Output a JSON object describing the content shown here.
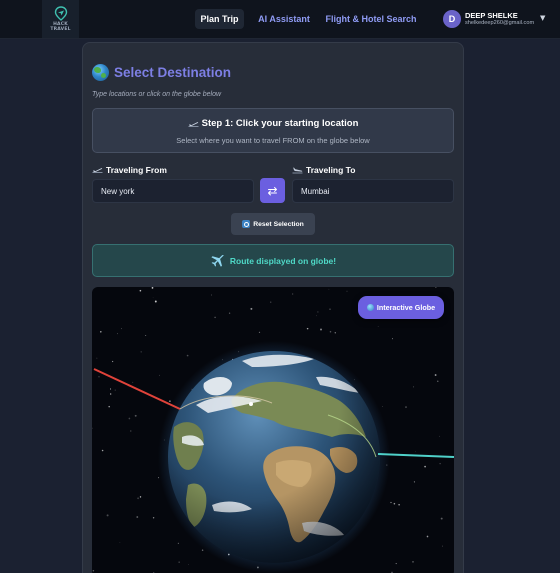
{
  "logo": {
    "line1": "HACK",
    "line2": "TRAVEL"
  },
  "nav": {
    "plan_trip": "Plan Trip",
    "ai_assistant": "AI Assistant",
    "flight_hotel": "Flight & Hotel Search"
  },
  "user": {
    "initial": "D",
    "name": "DEEP SHELKE",
    "email": "shelkedeep260@gmail.com",
    "menu_icon": "chevron-down-icon"
  },
  "destination": {
    "title": "Select Destination",
    "subtitle": "Type locations or click on the globe below"
  },
  "step": {
    "title": "Step 1: Click your starting location",
    "description": "Select where you want to travel FROM on the globe below"
  },
  "from": {
    "label": "Traveling From",
    "value": "New york"
  },
  "to": {
    "label": "Traveling To",
    "value": "Mumbai"
  },
  "swap_icon": "⇄",
  "reset_label": "Reset Selection",
  "route_status": "Route displayed on globe!",
  "globe_badge": "Interactive Globe",
  "colors": {
    "accent": "#6b5fe0",
    "title": "#7d7fe4",
    "route_text": "#4fd9c7",
    "route_line_origin": "#e0433a",
    "route_line_dest": "#4fd0c8"
  }
}
